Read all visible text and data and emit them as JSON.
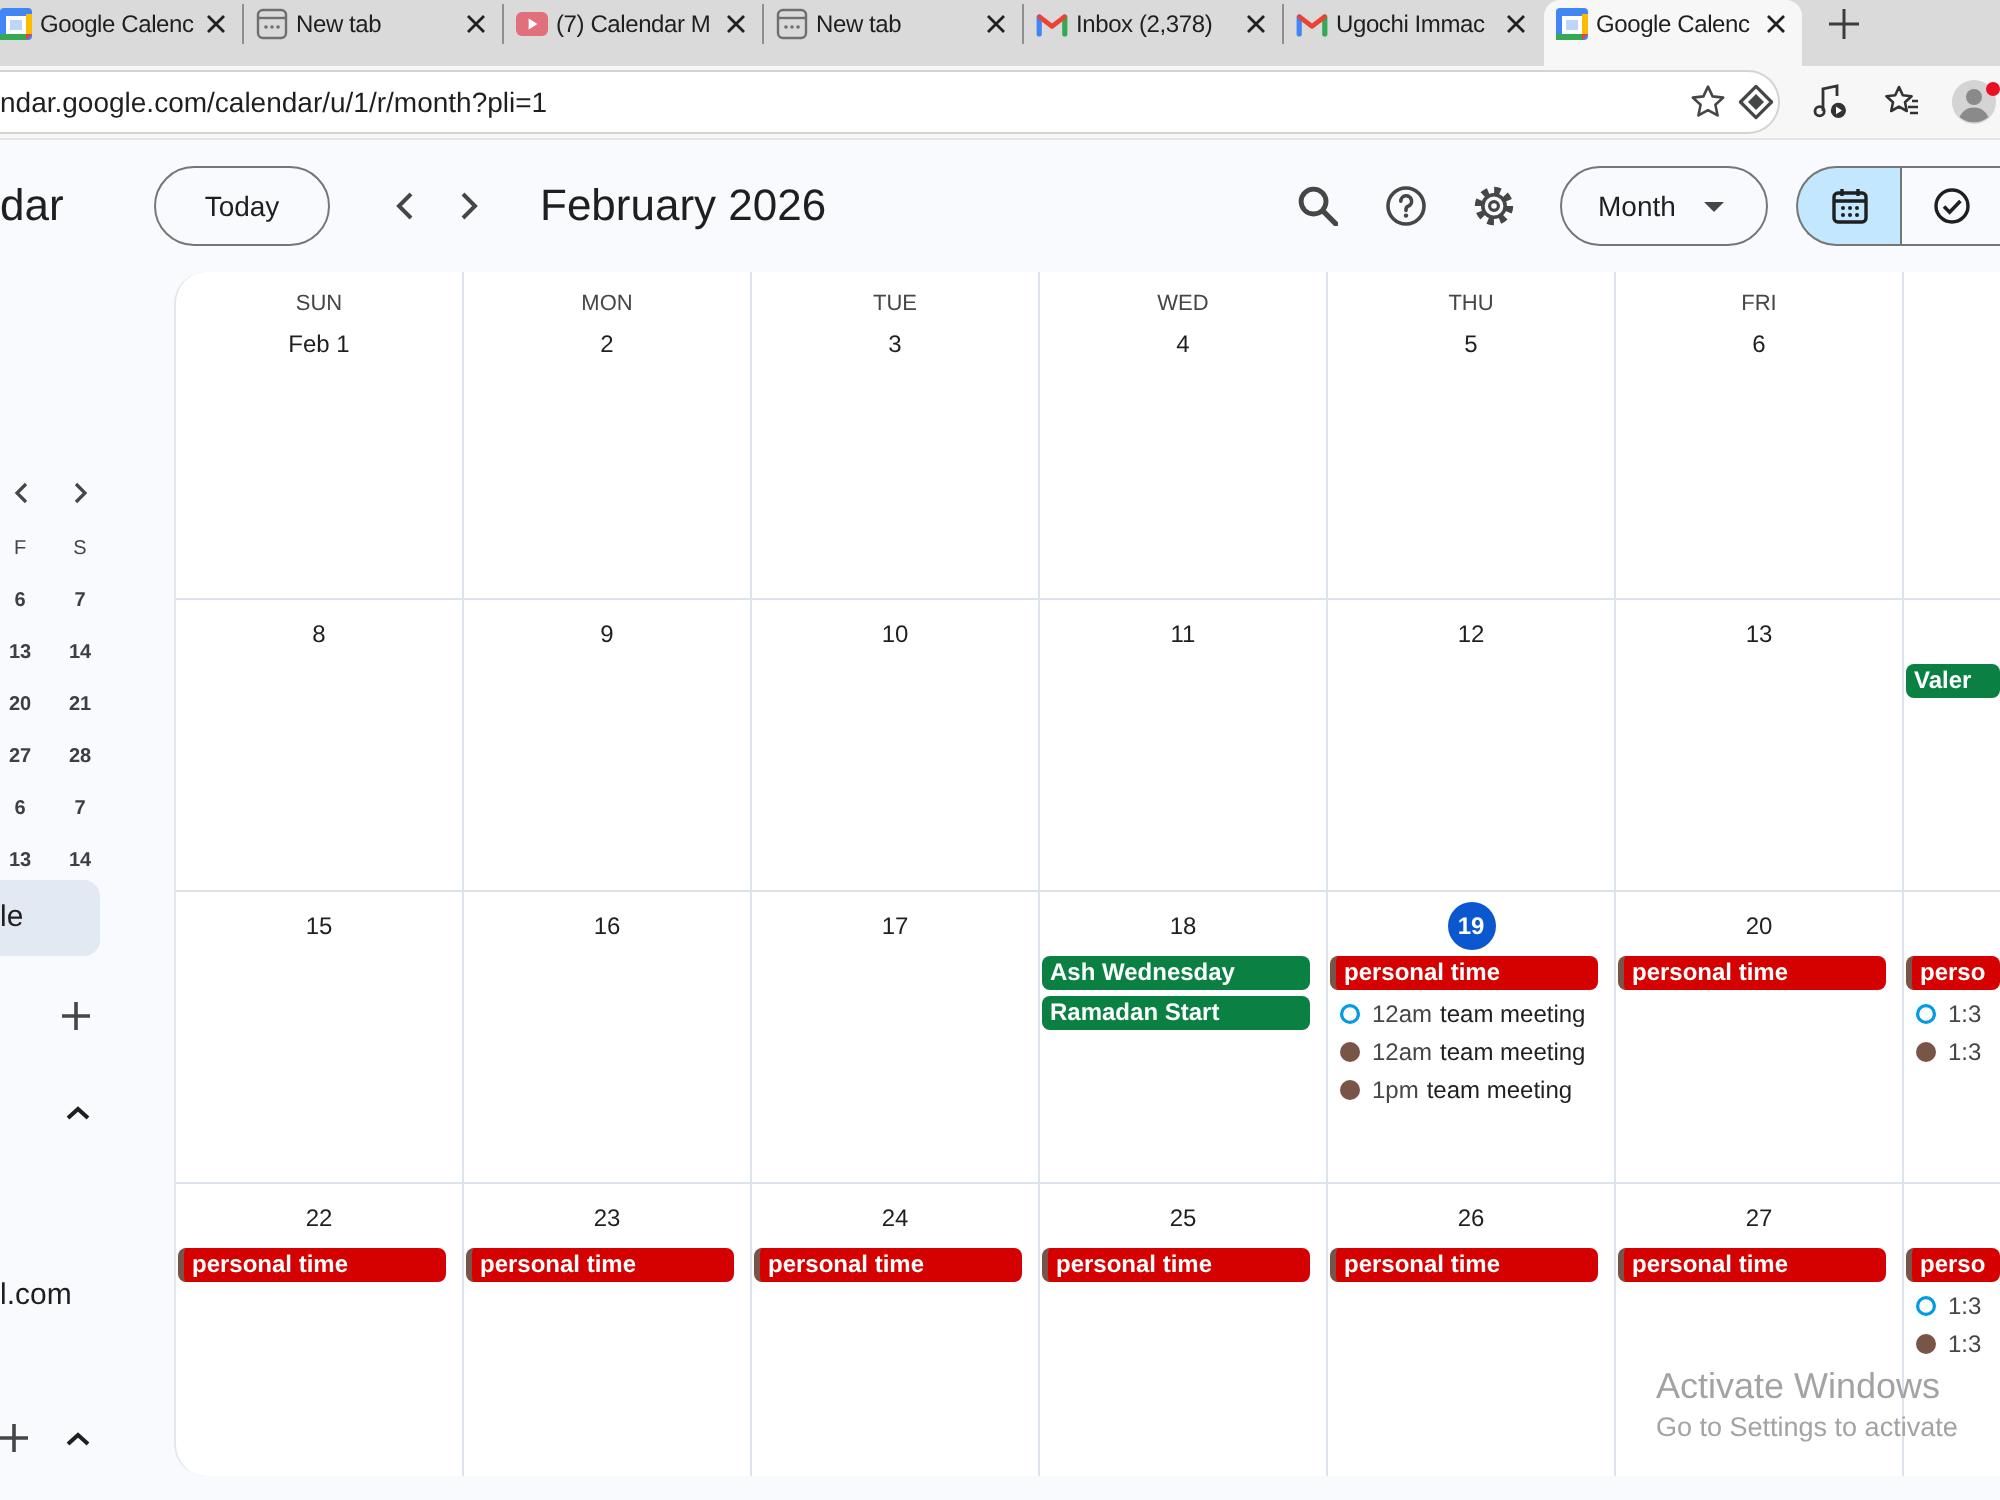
{
  "browser": {
    "tabs": [
      {
        "title": "Google Calenc",
        "kind": "calendar",
        "selected": false
      },
      {
        "title": "New tab",
        "kind": "page",
        "selected": false
      },
      {
        "title": "(7) Calendar M",
        "kind": "video",
        "selected": false
      },
      {
        "title": "New tab",
        "kind": "page",
        "selected": false
      },
      {
        "title": "Inbox (2,378)",
        "kind": "mail",
        "selected": false
      },
      {
        "title": "Ugochi Immac",
        "kind": "mail",
        "selected": false
      },
      {
        "title": "Google Calenc",
        "kind": "calendar",
        "selected": true
      }
    ],
    "address": "ndar.google.com/calendar/u/1/r/month?pli=1"
  },
  "header": {
    "app_title": "dar",
    "today_button": "Today",
    "period": "February 2026",
    "view_button": "Month",
    "view_toggle": [
      {
        "kind": "calendar",
        "selected": true
      },
      {
        "kind": "tasks",
        "selected": false
      }
    ]
  },
  "sidebar": {
    "mini_calendar": {
      "weekdays": [
        "F",
        "S"
      ],
      "weeks": [
        [
          "6",
          "7"
        ],
        [
          "13",
          "14"
        ],
        [
          "20",
          "21"
        ],
        [
          "27",
          "28"
        ],
        [
          "6",
          "7"
        ],
        [
          "13",
          "14"
        ]
      ]
    },
    "items": [
      {
        "label": "le",
        "selected": true
      }
    ],
    "account": "l.com"
  },
  "calendar": {
    "weekdays": [
      "SUN",
      "MON",
      "TUE",
      "WED",
      "THU",
      "FRI"
    ],
    "weeks": [
      {
        "days": [
          {
            "label": "Feb 1",
            "today": false
          },
          {
            "label": "2",
            "today": false
          },
          {
            "label": "3",
            "today": false
          },
          {
            "label": "4",
            "today": false
          },
          {
            "label": "5",
            "today": false
          },
          {
            "label": "6",
            "today": false
          }
        ]
      },
      {
        "days": [
          {
            "label": "8",
            "today": false
          },
          {
            "label": "9",
            "today": false
          },
          {
            "label": "10",
            "today": false
          },
          {
            "label": "11",
            "today": false
          },
          {
            "label": "12",
            "today": false
          },
          {
            "label": "13",
            "today": false
          }
        ],
        "partial_day": {
          "events": [
            {
              "kind": "chip",
              "title": "Valer",
              "color": "#0b8043"
            }
          ]
        }
      },
      {
        "days": [
          {
            "label": "15",
            "today": false
          },
          {
            "label": "16",
            "today": false
          },
          {
            "label": "17",
            "today": false
          },
          {
            "label": "18",
            "today": false,
            "events": [
              {
                "kind": "chip",
                "title": "Ash Wednesday",
                "color": "#0b8043"
              },
              {
                "kind": "chip",
                "title": "Ramadan Start",
                "color": "#0b8043"
              }
            ]
          },
          {
            "label": "19",
            "today": true,
            "events": [
              {
                "kind": "chip",
                "title": "personal time",
                "color": "#d50000",
                "edge": {
                  "color": "#795548"
                }
              },
              {
                "kind": "dot",
                "time": "12am",
                "title": "team meeting",
                "color": "#039be5",
                "outlined": true
              },
              {
                "kind": "dot",
                "time": "12am",
                "title": "team meeting",
                "color": "#795548",
                "outlined": false
              },
              {
                "kind": "dot",
                "time": "1pm",
                "title": "team meeting",
                "color": "#795548",
                "outlined": false
              }
            ]
          },
          {
            "label": "20",
            "today": false,
            "events": [
              {
                "kind": "chip",
                "title": "personal time",
                "color": "#d50000",
                "edge": {
                  "color": "#795548"
                }
              }
            ]
          }
        ],
        "partial_day": {
          "events": [
            {
              "kind": "chip",
              "title": "perso",
              "color": "#d50000",
              "edge": {
                "color": "#795548"
              }
            },
            {
              "kind": "dot",
              "time": "1:3",
              "color": "#039be5",
              "outlined": true
            },
            {
              "kind": "dot",
              "time": "1:3",
              "color": "#795548",
              "outlined": false
            }
          ]
        }
      },
      {
        "days": [
          {
            "label": "22",
            "today": false,
            "events": [
              {
                "kind": "chip",
                "title": "personal time",
                "color": "#d50000",
                "edge": {
                  "color": "#795548"
                }
              }
            ]
          },
          {
            "label": "23",
            "today": false,
            "events": [
              {
                "kind": "chip",
                "title": "personal time",
                "color": "#d50000",
                "edge": {
                  "color": "#795548"
                }
              }
            ]
          },
          {
            "label": "24",
            "today": false,
            "events": [
              {
                "kind": "chip",
                "title": "personal time",
                "color": "#d50000",
                "edge": {
                  "color": "#795548"
                }
              }
            ]
          },
          {
            "label": "25",
            "today": false,
            "events": [
              {
                "kind": "chip",
                "title": "personal time",
                "color": "#d50000",
                "edge": {
                  "color": "#795548"
                }
              }
            ]
          },
          {
            "label": "26",
            "today": false,
            "events": [
              {
                "kind": "chip",
                "title": "personal time",
                "color": "#d50000",
                "edge": {
                  "color": "#795548"
                }
              }
            ]
          },
          {
            "label": "27",
            "today": false,
            "events": [
              {
                "kind": "chip",
                "title": "personal time",
                "color": "#d50000",
                "edge": {
                  "color": "#795548"
                }
              }
            ]
          }
        ],
        "partial_day": {
          "events": [
            {
              "kind": "chip",
              "title": "perso",
              "color": "#d50000",
              "edge": {
                "color": "#795548"
              }
            },
            {
              "kind": "dot",
              "time": "1:3",
              "color": "#039be5",
              "outlined": true
            },
            {
              "kind": "dot",
              "time": "1:3",
              "color": "#795548",
              "outlined": false
            }
          ]
        }
      }
    ]
  },
  "os_notice": {
    "title": "Activate Windows",
    "message": "Go to Settings to activate"
  }
}
